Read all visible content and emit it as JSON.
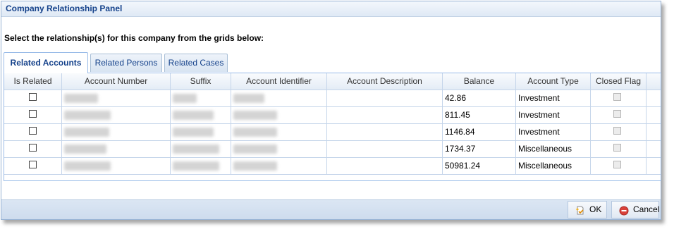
{
  "panel": {
    "title": "Company Relationship Panel"
  },
  "instruction": "Select the relationship(s) for this company from the grids below:",
  "tabs": [
    {
      "label": "Related Accounts",
      "active": true
    },
    {
      "label": "Related Persons",
      "active": false
    },
    {
      "label": "Related Cases",
      "active": false
    }
  ],
  "grid": {
    "columns": [
      "Is Related",
      "Account Number",
      "Suffix",
      "Account Identifier",
      "Account Description",
      "Balance",
      "Account Type",
      "Closed Flag"
    ],
    "rows": [
      {
        "balance": "42.86",
        "type": "Investment"
      },
      {
        "balance": "811.45",
        "type": "Investment"
      },
      {
        "balance": "1146.84",
        "type": "Investment"
      },
      {
        "balance": "1734.37",
        "type": "Miscellaneous"
      },
      {
        "balance": "50981.24",
        "type": "Miscellaneous"
      }
    ]
  },
  "buttons": {
    "ok": "OK",
    "cancel": "Cancel"
  },
  "colors": {
    "title": "#15428b",
    "border": "#99bbe8",
    "cancel_icon": "#d9413a"
  },
  "icons": {
    "ok": "document-check-icon",
    "cancel": "cancel-circle-icon"
  }
}
